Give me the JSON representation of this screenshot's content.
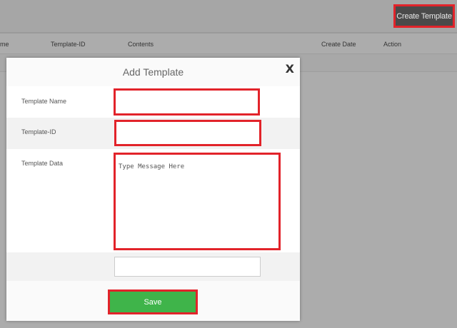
{
  "header": {
    "create_button_label": "Create Template"
  },
  "table": {
    "columns": [
      "me",
      "Template-ID",
      "Contents",
      "Create Date",
      "Action"
    ]
  },
  "modal": {
    "title": "Add Template",
    "close_label": "X",
    "fields": {
      "name_label": "Template Name",
      "name_value": "",
      "id_label": "Template-ID",
      "id_value": "",
      "data_label": "Template Data",
      "data_placeholder": "Type Message Here",
      "extra_value": ""
    },
    "save_label": "Save"
  },
  "colors": {
    "highlight": "#e2232a",
    "save": "#3fb44a",
    "create_button": "#4a4a4a"
  }
}
